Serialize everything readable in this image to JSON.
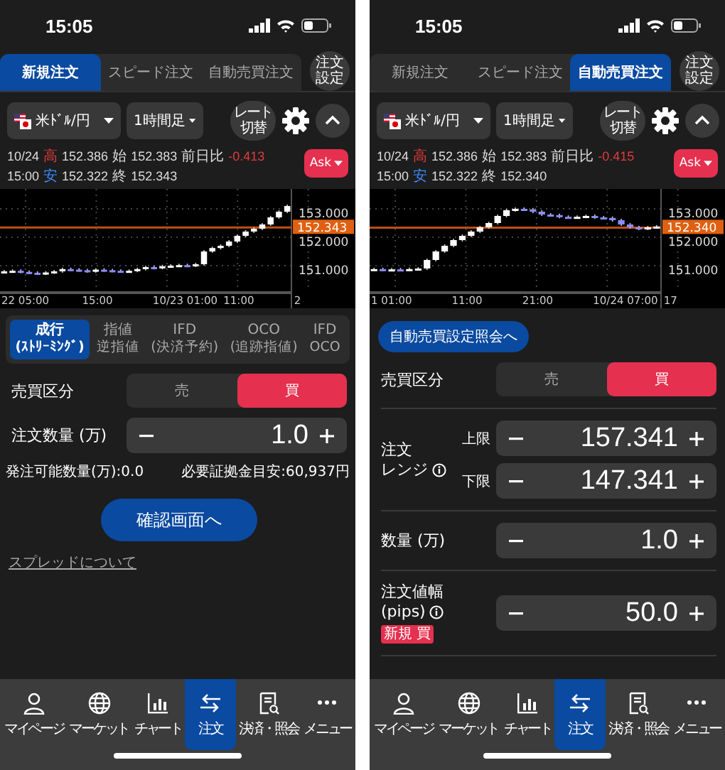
{
  "screens": [
    {
      "status_time": "15:05",
      "tabs": [
        {
          "label": "新規注文",
          "selected": true
        },
        {
          "label": "スピード注文",
          "selected": false
        },
        {
          "label": "自動売買注文",
          "selected": false
        }
      ],
      "settings_button": "注文設定",
      "pair": "米ﾄﾞﾙ/円",
      "period": "1時間足",
      "rate_toggle": "レート切替",
      "ask_button": "Ask",
      "quote": {
        "date": "10/24",
        "time": "15:00",
        "high_label": "高",
        "high": "152.386",
        "open_label": "始",
        "open": "152.383",
        "change_label": "前日比",
        "change": "-0.413",
        "low_label": "安",
        "low": "152.322",
        "close_label": "終",
        "close": "152.343"
      },
      "chart": {
        "y_labels": [
          "153.000",
          "152.000",
          "151.000"
        ],
        "x_labels": [
          "22 05:00",
          "15:00",
          "10/23 01:00",
          "11:00",
          "2"
        ],
        "price_tag": "152.343"
      },
      "body": [
        {
          "kind": "order_types",
          "options": [
            {
              "label": "成行",
              "sub": "(ｽﾄﾘｰﾐﾝｸﾞ)",
              "selected": true
            },
            {
              "label": "指値",
              "sub": "逆指値",
              "selected": false
            },
            {
              "label": "IFD",
              "sub": "(決済予約)",
              "selected": false
            },
            {
              "label": "OCO",
              "sub": "(追跡指値)",
              "selected": false
            },
            {
              "label": "IFD",
              "sub": "OCO",
              "selected": false
            }
          ]
        },
        {
          "kind": "side",
          "label": "売買区分",
          "options": [
            {
              "label": "売",
              "selected": false
            },
            {
              "label": "買",
              "selected": true
            }
          ]
        },
        {
          "kind": "stepper",
          "label": [
            "注文数量 (万)"
          ],
          "value": "1.0"
        },
        {
          "kind": "note",
          "left": "発注可能数量(万):0.0",
          "right": "必要証拠金目安:60,937円"
        },
        {
          "kind": "primary_button",
          "label": "確認画面へ"
        },
        {
          "kind": "link",
          "label": "スプレッドについて"
        }
      ],
      "nav": [
        {
          "label": "マイページ",
          "selected": false
        },
        {
          "label": "マーケット",
          "selected": false
        },
        {
          "label": "チャート",
          "selected": false
        },
        {
          "label": "注文",
          "selected": true
        },
        {
          "label": "決済・照会",
          "selected": false
        },
        {
          "label": "メニュー",
          "selected": false
        }
      ]
    },
    {
      "status_time": "15:05",
      "tabs": [
        {
          "label": "新規注文",
          "selected": false
        },
        {
          "label": "スピード注文",
          "selected": false
        },
        {
          "label": "自動売買注文",
          "selected": true
        }
      ],
      "settings_button": "注文設定",
      "pair": "米ﾄﾞﾙ/円",
      "period": "1時間足",
      "rate_toggle": "レート切替",
      "ask_button": "Ask",
      "quote": {
        "date": "10/24",
        "time": "15:00",
        "high_label": "高",
        "high": "152.386",
        "open_label": "始",
        "open": "152.383",
        "change_label": "前日比",
        "change": "-0.415",
        "low_label": "安",
        "low": "152.322",
        "close_label": "終",
        "close": "152.340"
      },
      "chart": {
        "y_labels": [
          "153.000",
          "152.000",
          "151.000"
        ],
        "x_labels": [
          "1 01:00",
          "11:00",
          "21:00",
          "10/24 07:00",
          "17"
        ],
        "price_tag": "152.340"
      },
      "body": [
        {
          "kind": "secondary_button",
          "label": "自動売買設定照会へ"
        },
        {
          "kind": "side",
          "label": "売買区分",
          "options": [
            {
              "label": "売",
              "selected": false
            },
            {
              "label": "買",
              "selected": true
            }
          ]
        },
        {
          "kind": "divider"
        },
        {
          "kind": "range",
          "label": [
            "注文",
            "レンジ"
          ],
          "info": true,
          "rows": [
            {
              "label": "上限",
              "value": "157.341"
            },
            {
              "label": "下限",
              "value": "147.341"
            }
          ]
        },
        {
          "kind": "divider"
        },
        {
          "kind": "stepper",
          "label": [
            "数量 (万)"
          ],
          "value": "1.0"
        },
        {
          "kind": "divider"
        },
        {
          "kind": "stepper",
          "label": [
            "注文値幅",
            "(pips)"
          ],
          "info": true,
          "badge": "新規 買",
          "value": "50.0"
        },
        {
          "kind": "divider"
        }
      ],
      "nav": [
        {
          "label": "マイページ",
          "selected": false
        },
        {
          "label": "マーケット",
          "selected": false
        },
        {
          "label": "チャート",
          "selected": false
        },
        {
          "label": "注文",
          "selected": true
        },
        {
          "label": "決済・照会",
          "selected": false
        },
        {
          "label": "メニュー",
          "selected": false
        }
      ]
    }
  ]
}
